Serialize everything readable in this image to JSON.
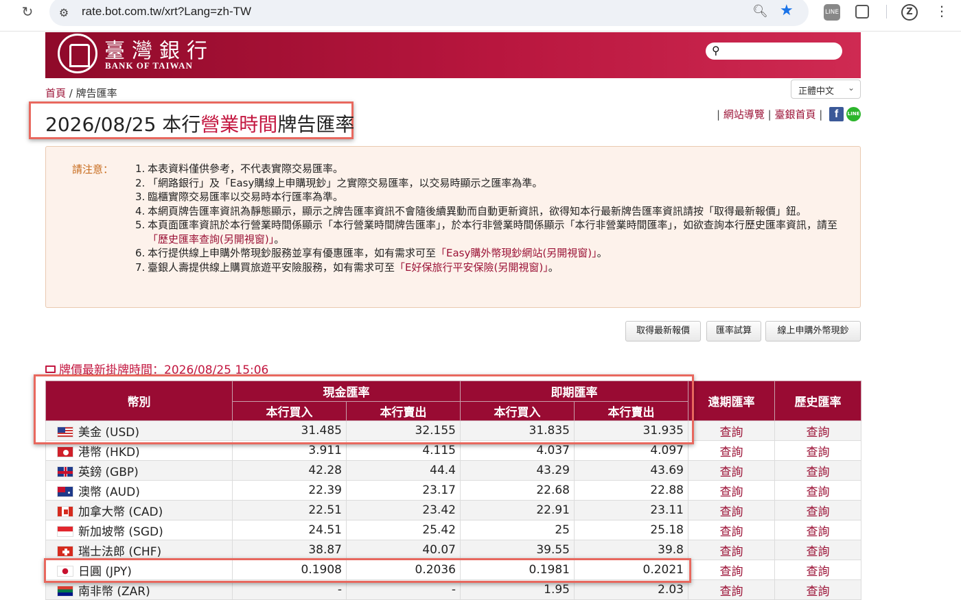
{
  "browser": {
    "url": "rate.bot.com.tw/xrt?Lang=zh-TW",
    "ext_line_label": "LINE",
    "profile_label": "Z"
  },
  "banner": {
    "bank_name_zh": "臺灣銀行",
    "bank_name_en": "BANK OF TAIWAN",
    "search_placeholder": ""
  },
  "breadcrumb": {
    "home": "首頁",
    "separator": " / ",
    "current": "牌告匯率"
  },
  "lang_select": "正體中文",
  "title": {
    "date": "2026/08/25 本行",
    "highlight": "營業時間",
    "suffix": "牌告匯率"
  },
  "top_links": {
    "sitemap": "網站導覽",
    "homepage": "臺銀首頁",
    "sep": " | "
  },
  "notice": {
    "label": "請注意：",
    "items": [
      {
        "n": "1.",
        "parts": [
          "本表資料僅供參考，不代表實際交易匯率。"
        ]
      },
      {
        "n": "2.",
        "parts": [
          "「網路銀行」及「Easy購線上申購現鈔」之實際交易匯率，以交易時顯示之匯率為準。"
        ]
      },
      {
        "n": "3.",
        "parts": [
          "臨櫃實際交易匯率以交易時本行匯率為準。"
        ]
      },
      {
        "n": "4.",
        "parts": [
          "本網頁牌告匯率資訊為靜態顯示，顯示之牌告匯率資訊不會隨後續異動而自動更新資訊，欲得知本行最新牌告匯率資訊請按「取得最新報價」鈕。"
        ]
      },
      {
        "n": "5.",
        "parts": [
          "本頁面匯率資訊於本行營業時間係顯示「本行營業時間牌告匯率」，於本行非營業時間係顯示「本行非營業時間匯率」，如欲查詢本行歷史匯率資訊，請至",
          "「歷史匯率查詢(另開視窗)」",
          "。"
        ]
      },
      {
        "n": "6.",
        "parts": [
          "本行提供線上申購外幣現鈔服務並享有優惠匯率，如有需求可至",
          "「Easy購外幣現鈔網站(另開視窗)」",
          "。"
        ]
      },
      {
        "n": "7.",
        "parts": [
          "臺銀人壽提供線上購買旅遊平安險服務，如有需求可至",
          "「E好保旅行平安保險(另開視窗)」",
          "。"
        ]
      }
    ]
  },
  "buttons": {
    "latest": "取得最新報價",
    "calc": "匯率試算",
    "buy": "線上申購外幣現鈔"
  },
  "posted": "牌價最新掛牌時間：2026/08/25 15:06",
  "table": {
    "headers": {
      "currency": "幣別",
      "cash": "現金匯率",
      "spot": "即期匯率",
      "forward": "遠期匯率",
      "history": "歷史匯率",
      "buy": "本行買入",
      "sell": "本行賣出"
    },
    "query_label": "查詢",
    "rows": [
      {
        "name": "美金 (USD)",
        "flag": "us",
        "cash_buy": "31.485",
        "cash_sell": "32.155",
        "spot_buy": "31.835",
        "spot_sell": "31.935"
      },
      {
        "name": "港幣 (HKD)",
        "flag": "hk",
        "cash_buy": "3.911",
        "cash_sell": "4.115",
        "spot_buy": "4.037",
        "spot_sell": "4.097"
      },
      {
        "name": "英鎊 (GBP)",
        "flag": "gb",
        "cash_buy": "42.28",
        "cash_sell": "44.4",
        "spot_buy": "43.29",
        "spot_sell": "43.69"
      },
      {
        "name": "澳幣 (AUD)",
        "flag": "au",
        "cash_buy": "22.39",
        "cash_sell": "23.17",
        "spot_buy": "22.68",
        "spot_sell": "22.88"
      },
      {
        "name": "加拿大幣 (CAD)",
        "flag": "ca",
        "cash_buy": "22.51",
        "cash_sell": "23.42",
        "spot_buy": "22.91",
        "spot_sell": "23.11"
      },
      {
        "name": "新加坡幣 (SGD)",
        "flag": "sg",
        "cash_buy": "24.51",
        "cash_sell": "25.42",
        "spot_buy": "25",
        "spot_sell": "25.18"
      },
      {
        "name": "瑞士法郎 (CHF)",
        "flag": "ch",
        "cash_buy": "38.87",
        "cash_sell": "40.07",
        "spot_buy": "39.55",
        "spot_sell": "39.8"
      },
      {
        "name": "日圓 (JPY)",
        "flag": "jp",
        "cash_buy": "0.1908",
        "cash_sell": "0.2036",
        "spot_buy": "0.1981",
        "spot_sell": "0.2021"
      },
      {
        "name": "南非幣 (ZAR)",
        "flag": "za",
        "cash_buy": "-",
        "cash_sell": "-",
        "spot_buy": "1.95",
        "spot_sell": "2.03"
      }
    ]
  },
  "colors": {
    "brand": "#990b33",
    "link": "#9b1236",
    "highlight_border": "#e8685e",
    "notice_bg": "#fdf2eb"
  }
}
